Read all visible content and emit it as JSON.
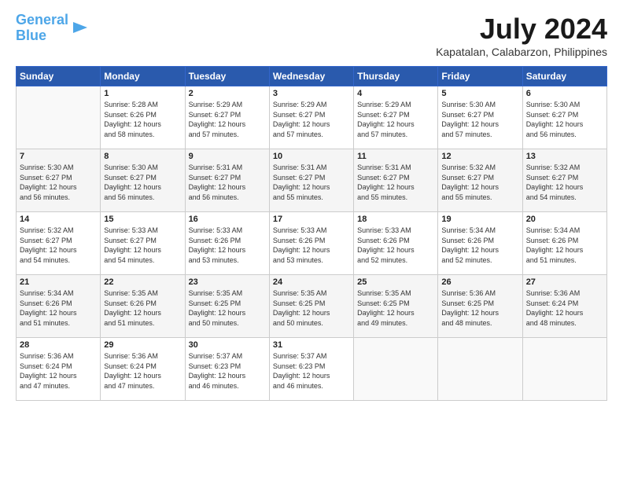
{
  "header": {
    "logo_line1": "General",
    "logo_line2": "Blue",
    "title": "July 2024",
    "location": "Kapatalan, Calabarzon, Philippines"
  },
  "days_of_week": [
    "Sunday",
    "Monday",
    "Tuesday",
    "Wednesday",
    "Thursday",
    "Friday",
    "Saturday"
  ],
  "weeks": [
    [
      {
        "day": "",
        "content": ""
      },
      {
        "day": "1",
        "content": "Sunrise: 5:28 AM\nSunset: 6:26 PM\nDaylight: 12 hours\nand 58 minutes."
      },
      {
        "day": "2",
        "content": "Sunrise: 5:29 AM\nSunset: 6:27 PM\nDaylight: 12 hours\nand 57 minutes."
      },
      {
        "day": "3",
        "content": "Sunrise: 5:29 AM\nSunset: 6:27 PM\nDaylight: 12 hours\nand 57 minutes."
      },
      {
        "day": "4",
        "content": "Sunrise: 5:29 AM\nSunset: 6:27 PM\nDaylight: 12 hours\nand 57 minutes."
      },
      {
        "day": "5",
        "content": "Sunrise: 5:30 AM\nSunset: 6:27 PM\nDaylight: 12 hours\nand 57 minutes."
      },
      {
        "day": "6",
        "content": "Sunrise: 5:30 AM\nSunset: 6:27 PM\nDaylight: 12 hours\nand 56 minutes."
      }
    ],
    [
      {
        "day": "7",
        "content": "Sunrise: 5:30 AM\nSunset: 6:27 PM\nDaylight: 12 hours\nand 56 minutes."
      },
      {
        "day": "8",
        "content": "Sunrise: 5:30 AM\nSunset: 6:27 PM\nDaylight: 12 hours\nand 56 minutes."
      },
      {
        "day": "9",
        "content": "Sunrise: 5:31 AM\nSunset: 6:27 PM\nDaylight: 12 hours\nand 56 minutes."
      },
      {
        "day": "10",
        "content": "Sunrise: 5:31 AM\nSunset: 6:27 PM\nDaylight: 12 hours\nand 55 minutes."
      },
      {
        "day": "11",
        "content": "Sunrise: 5:31 AM\nSunset: 6:27 PM\nDaylight: 12 hours\nand 55 minutes."
      },
      {
        "day": "12",
        "content": "Sunrise: 5:32 AM\nSunset: 6:27 PM\nDaylight: 12 hours\nand 55 minutes."
      },
      {
        "day": "13",
        "content": "Sunrise: 5:32 AM\nSunset: 6:27 PM\nDaylight: 12 hours\nand 54 minutes."
      }
    ],
    [
      {
        "day": "14",
        "content": "Sunrise: 5:32 AM\nSunset: 6:27 PM\nDaylight: 12 hours\nand 54 minutes."
      },
      {
        "day": "15",
        "content": "Sunrise: 5:33 AM\nSunset: 6:27 PM\nDaylight: 12 hours\nand 54 minutes."
      },
      {
        "day": "16",
        "content": "Sunrise: 5:33 AM\nSunset: 6:26 PM\nDaylight: 12 hours\nand 53 minutes."
      },
      {
        "day": "17",
        "content": "Sunrise: 5:33 AM\nSunset: 6:26 PM\nDaylight: 12 hours\nand 53 minutes."
      },
      {
        "day": "18",
        "content": "Sunrise: 5:33 AM\nSunset: 6:26 PM\nDaylight: 12 hours\nand 52 minutes."
      },
      {
        "day": "19",
        "content": "Sunrise: 5:34 AM\nSunset: 6:26 PM\nDaylight: 12 hours\nand 52 minutes."
      },
      {
        "day": "20",
        "content": "Sunrise: 5:34 AM\nSunset: 6:26 PM\nDaylight: 12 hours\nand 51 minutes."
      }
    ],
    [
      {
        "day": "21",
        "content": "Sunrise: 5:34 AM\nSunset: 6:26 PM\nDaylight: 12 hours\nand 51 minutes."
      },
      {
        "day": "22",
        "content": "Sunrise: 5:35 AM\nSunset: 6:26 PM\nDaylight: 12 hours\nand 51 minutes."
      },
      {
        "day": "23",
        "content": "Sunrise: 5:35 AM\nSunset: 6:25 PM\nDaylight: 12 hours\nand 50 minutes."
      },
      {
        "day": "24",
        "content": "Sunrise: 5:35 AM\nSunset: 6:25 PM\nDaylight: 12 hours\nand 50 minutes."
      },
      {
        "day": "25",
        "content": "Sunrise: 5:35 AM\nSunset: 6:25 PM\nDaylight: 12 hours\nand 49 minutes."
      },
      {
        "day": "26",
        "content": "Sunrise: 5:36 AM\nSunset: 6:25 PM\nDaylight: 12 hours\nand 48 minutes."
      },
      {
        "day": "27",
        "content": "Sunrise: 5:36 AM\nSunset: 6:24 PM\nDaylight: 12 hours\nand 48 minutes."
      }
    ],
    [
      {
        "day": "28",
        "content": "Sunrise: 5:36 AM\nSunset: 6:24 PM\nDaylight: 12 hours\nand 47 minutes."
      },
      {
        "day": "29",
        "content": "Sunrise: 5:36 AM\nSunset: 6:24 PM\nDaylight: 12 hours\nand 47 minutes."
      },
      {
        "day": "30",
        "content": "Sunrise: 5:37 AM\nSunset: 6:23 PM\nDaylight: 12 hours\nand 46 minutes."
      },
      {
        "day": "31",
        "content": "Sunrise: 5:37 AM\nSunset: 6:23 PM\nDaylight: 12 hours\nand 46 minutes."
      },
      {
        "day": "",
        "content": ""
      },
      {
        "day": "",
        "content": ""
      },
      {
        "day": "",
        "content": ""
      }
    ]
  ]
}
